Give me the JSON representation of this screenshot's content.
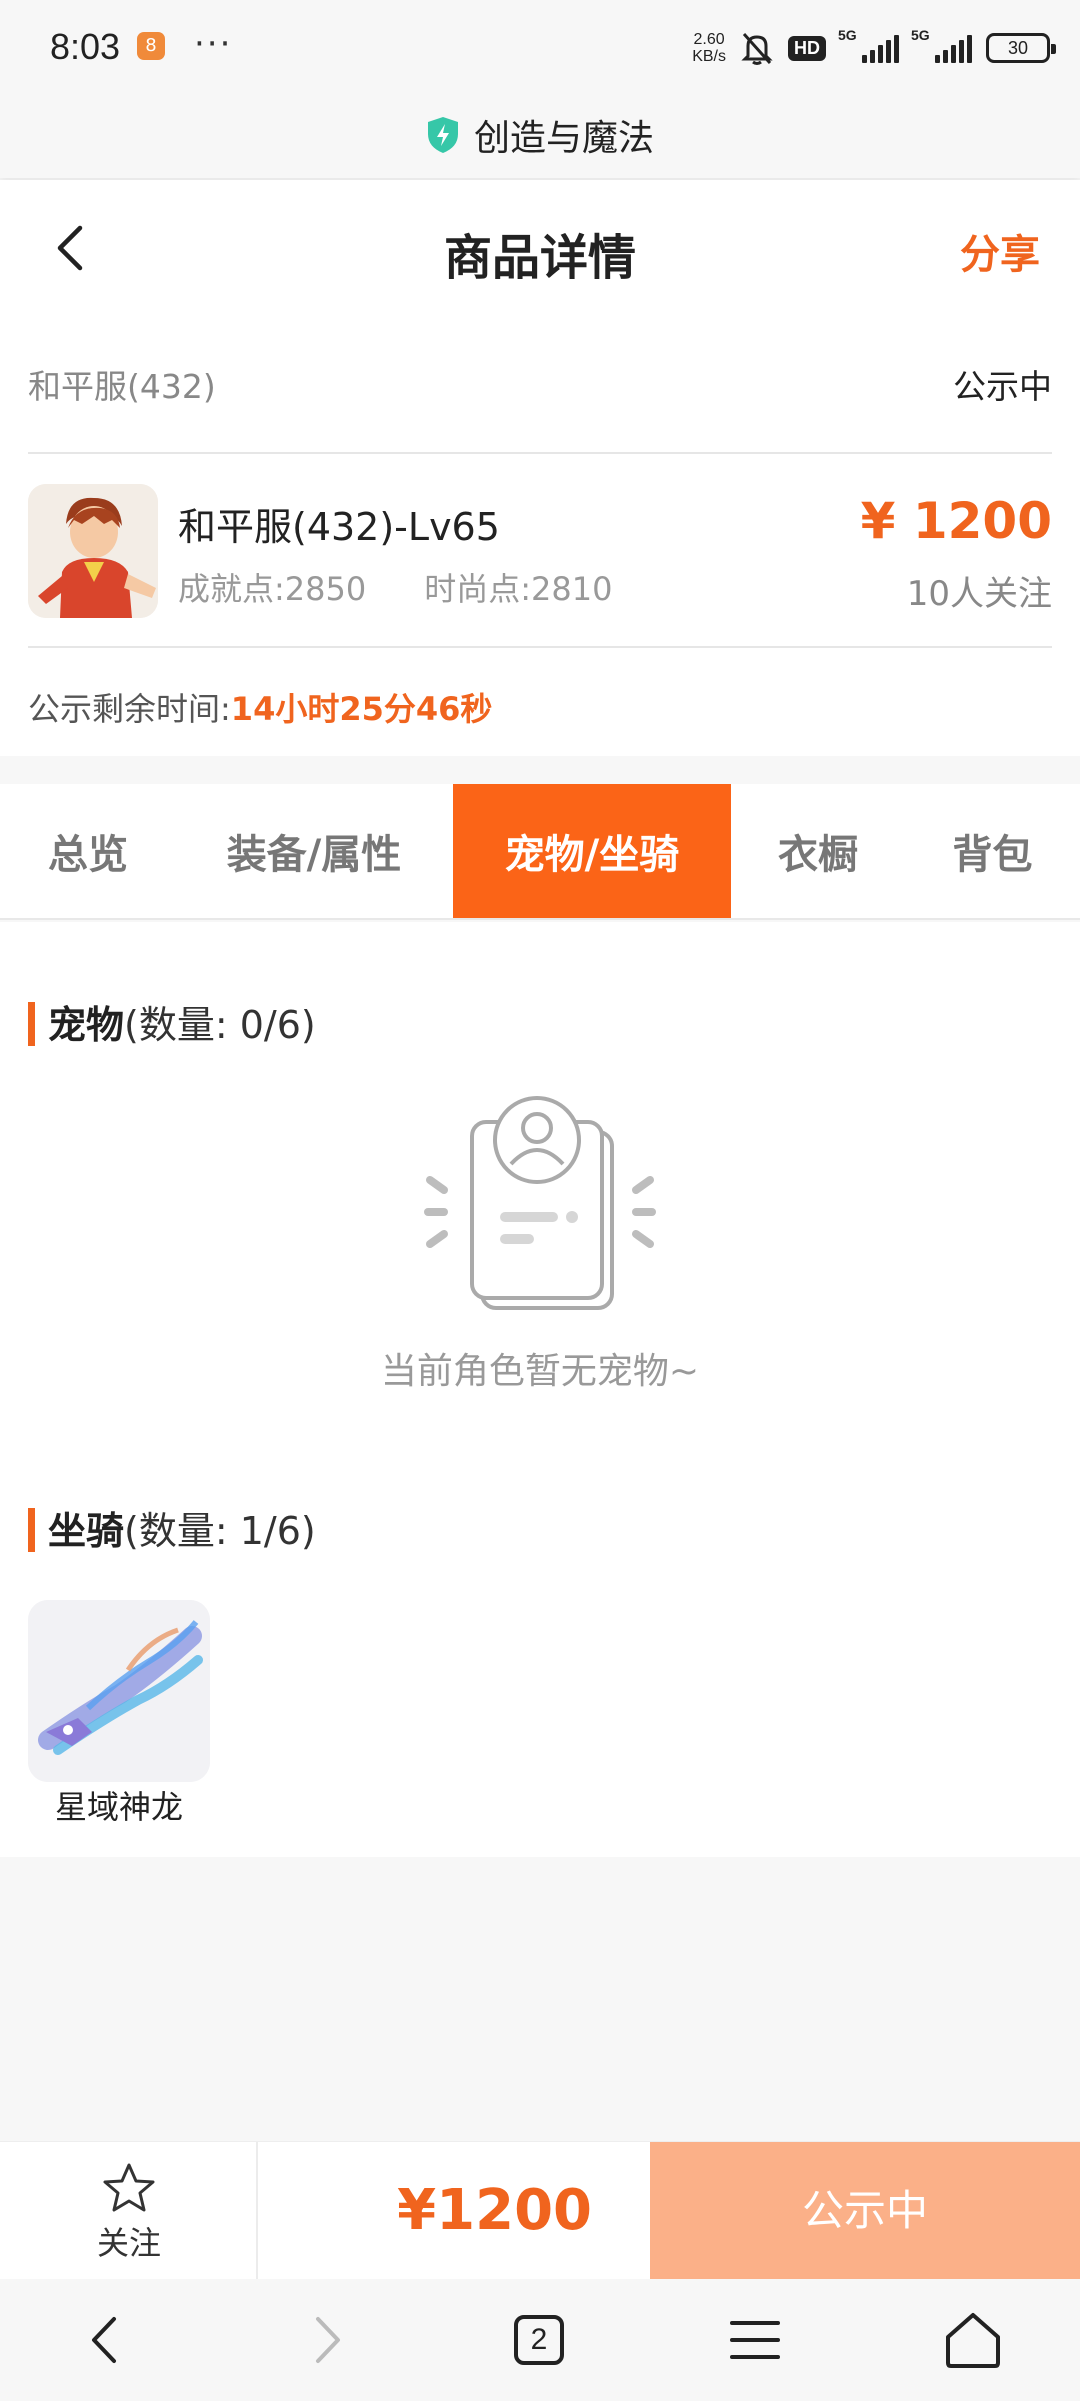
{
  "status_bar": {
    "time": "8:03",
    "app_badge": "8",
    "more": "···",
    "net_speed_value": "2.60",
    "net_speed_unit": "KB/s",
    "hd_label": "HD",
    "signal_1_label": "5G",
    "signal_2_label": "5G",
    "battery": "30"
  },
  "miniprogram": {
    "name": "创造与魔法"
  },
  "header": {
    "title": "商品详情",
    "share_label": "分享"
  },
  "product": {
    "server": "和平服(432)",
    "status": "公示中",
    "name": "和平服(432)-Lv65",
    "achievement_points": "成就点:2850",
    "fashion_points": "时尚点:2810",
    "price": "¥ 1200",
    "watchers": "10人关注",
    "countdown_label": "公示剩余时间:",
    "countdown_value": "14小时25分46秒"
  },
  "tabs": [
    {
      "label": "总览",
      "active": false
    },
    {
      "label": "装备/属性",
      "active": false
    },
    {
      "label": "宠物/坐骑",
      "active": true
    },
    {
      "label": "衣橱",
      "active": false
    },
    {
      "label": "背包",
      "active": false
    }
  ],
  "pets": {
    "title": "宠物",
    "count": "(数量: 0/6)",
    "empty_text": "当前角色暂无宠物~"
  },
  "mounts": {
    "title": "坐骑",
    "count": "(数量: 1/6)",
    "items": [
      {
        "name": "星域神龙"
      }
    ]
  },
  "action_bar": {
    "follow_label": "关注",
    "price": "¥1200",
    "status_button": "公示中"
  },
  "system_nav": {
    "tab_count": "2"
  },
  "colors": {
    "accent": "#f0641e",
    "tab_active": "#fb6417",
    "status_button": "#fbb088"
  }
}
